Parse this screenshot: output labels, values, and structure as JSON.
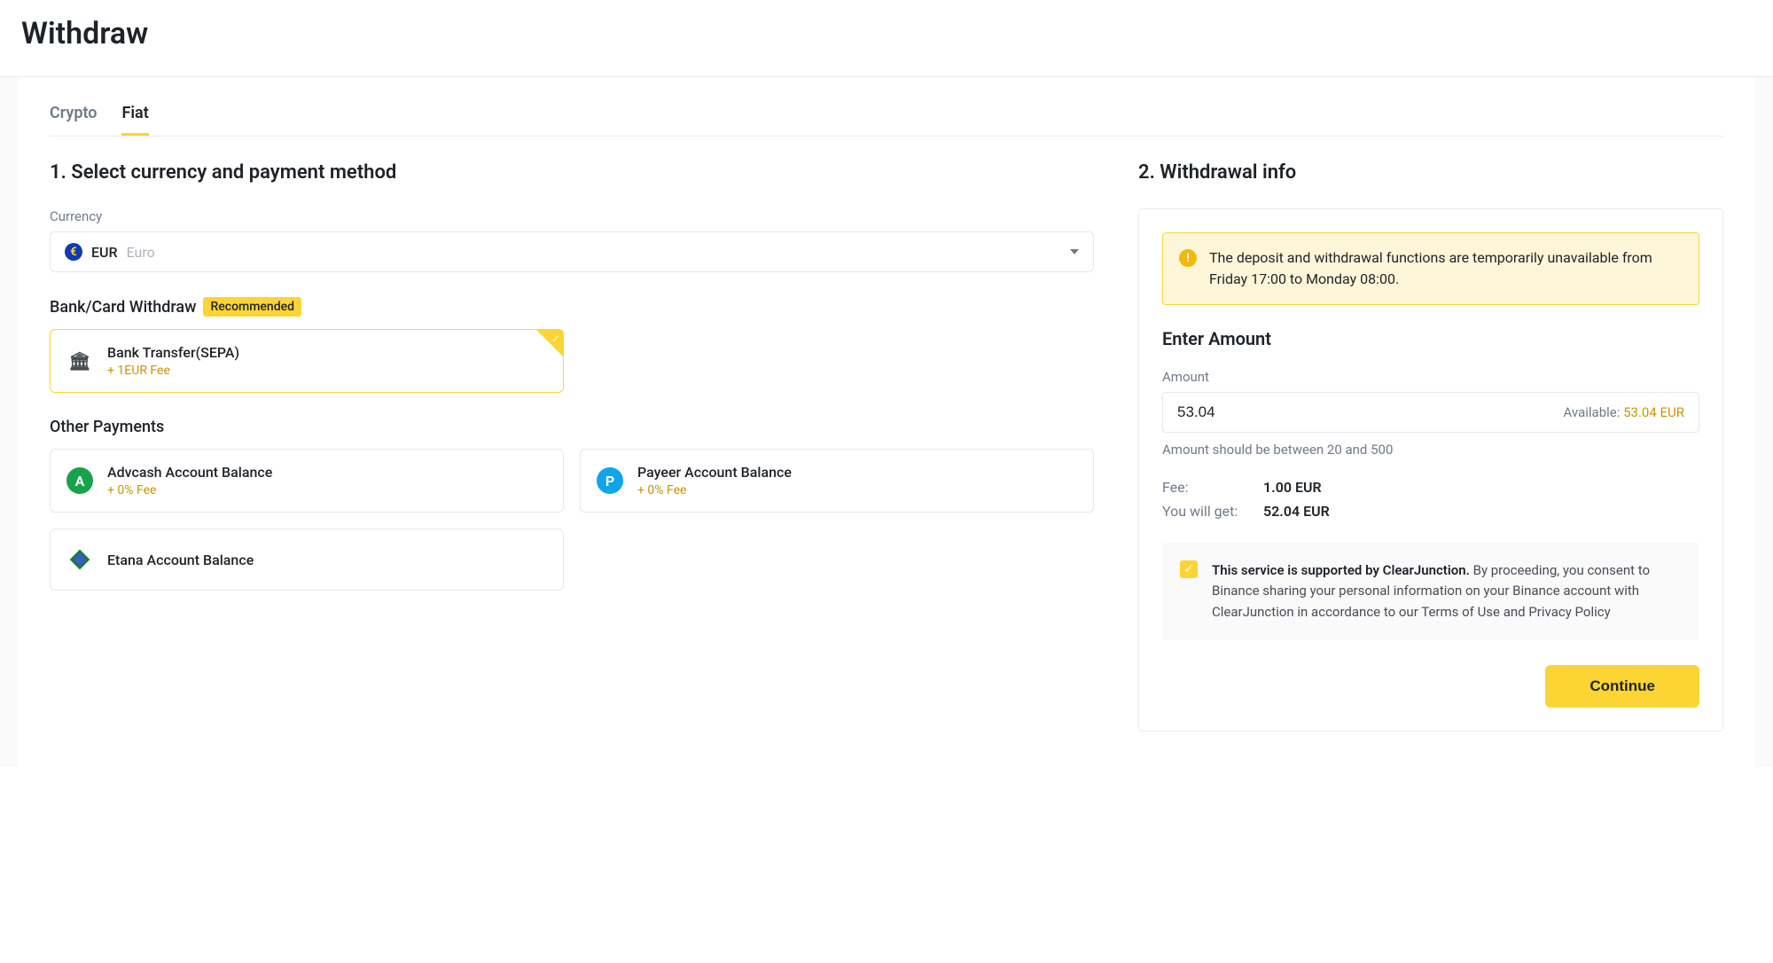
{
  "page_title": "Withdraw",
  "tabs": {
    "crypto": "Crypto",
    "fiat": "Fiat"
  },
  "left": {
    "section_title": "1. Select currency and payment method",
    "currency_label": "Currency",
    "currency_code": "EUR",
    "currency_name": "Euro",
    "bank_card_section": "Bank/Card Withdraw",
    "recommended_badge": "Recommended",
    "other_payments_section": "Other Payments",
    "options": {
      "sepa": {
        "name": "Bank Transfer(SEPA)",
        "fee": "+ 1EUR Fee"
      },
      "advcash": {
        "name": "Advcash Account Balance",
        "fee": "+ 0% Fee"
      },
      "payeer": {
        "name": "Payeer Account Balance",
        "fee": "+ 0% Fee"
      },
      "etana": {
        "name": "Etana Account Balance"
      }
    }
  },
  "right": {
    "section_title": "2. Withdrawal info",
    "alert": "The deposit and withdrawal functions are temporarily unavailable from Friday 17:00 to Monday 08:00.",
    "enter_amount_title": "Enter Amount",
    "amount_label": "Amount",
    "amount_value": "53.04",
    "available_label": "Available: ",
    "available_value": "53.04 EUR",
    "hint": "Amount should be between 20 and 500",
    "fee_label": "Fee:",
    "fee_value": "1.00 EUR",
    "youget_label": "You will get:",
    "youget_value": "52.04 EUR",
    "consent_bold": "This service is supported by ClearJunction.",
    "consent_rest": " By proceeding, you consent to Binance sharing your personal information on your Binance account with ClearJunction in accordance to our Terms of Use and Privacy Policy",
    "continue_label": "Continue"
  }
}
